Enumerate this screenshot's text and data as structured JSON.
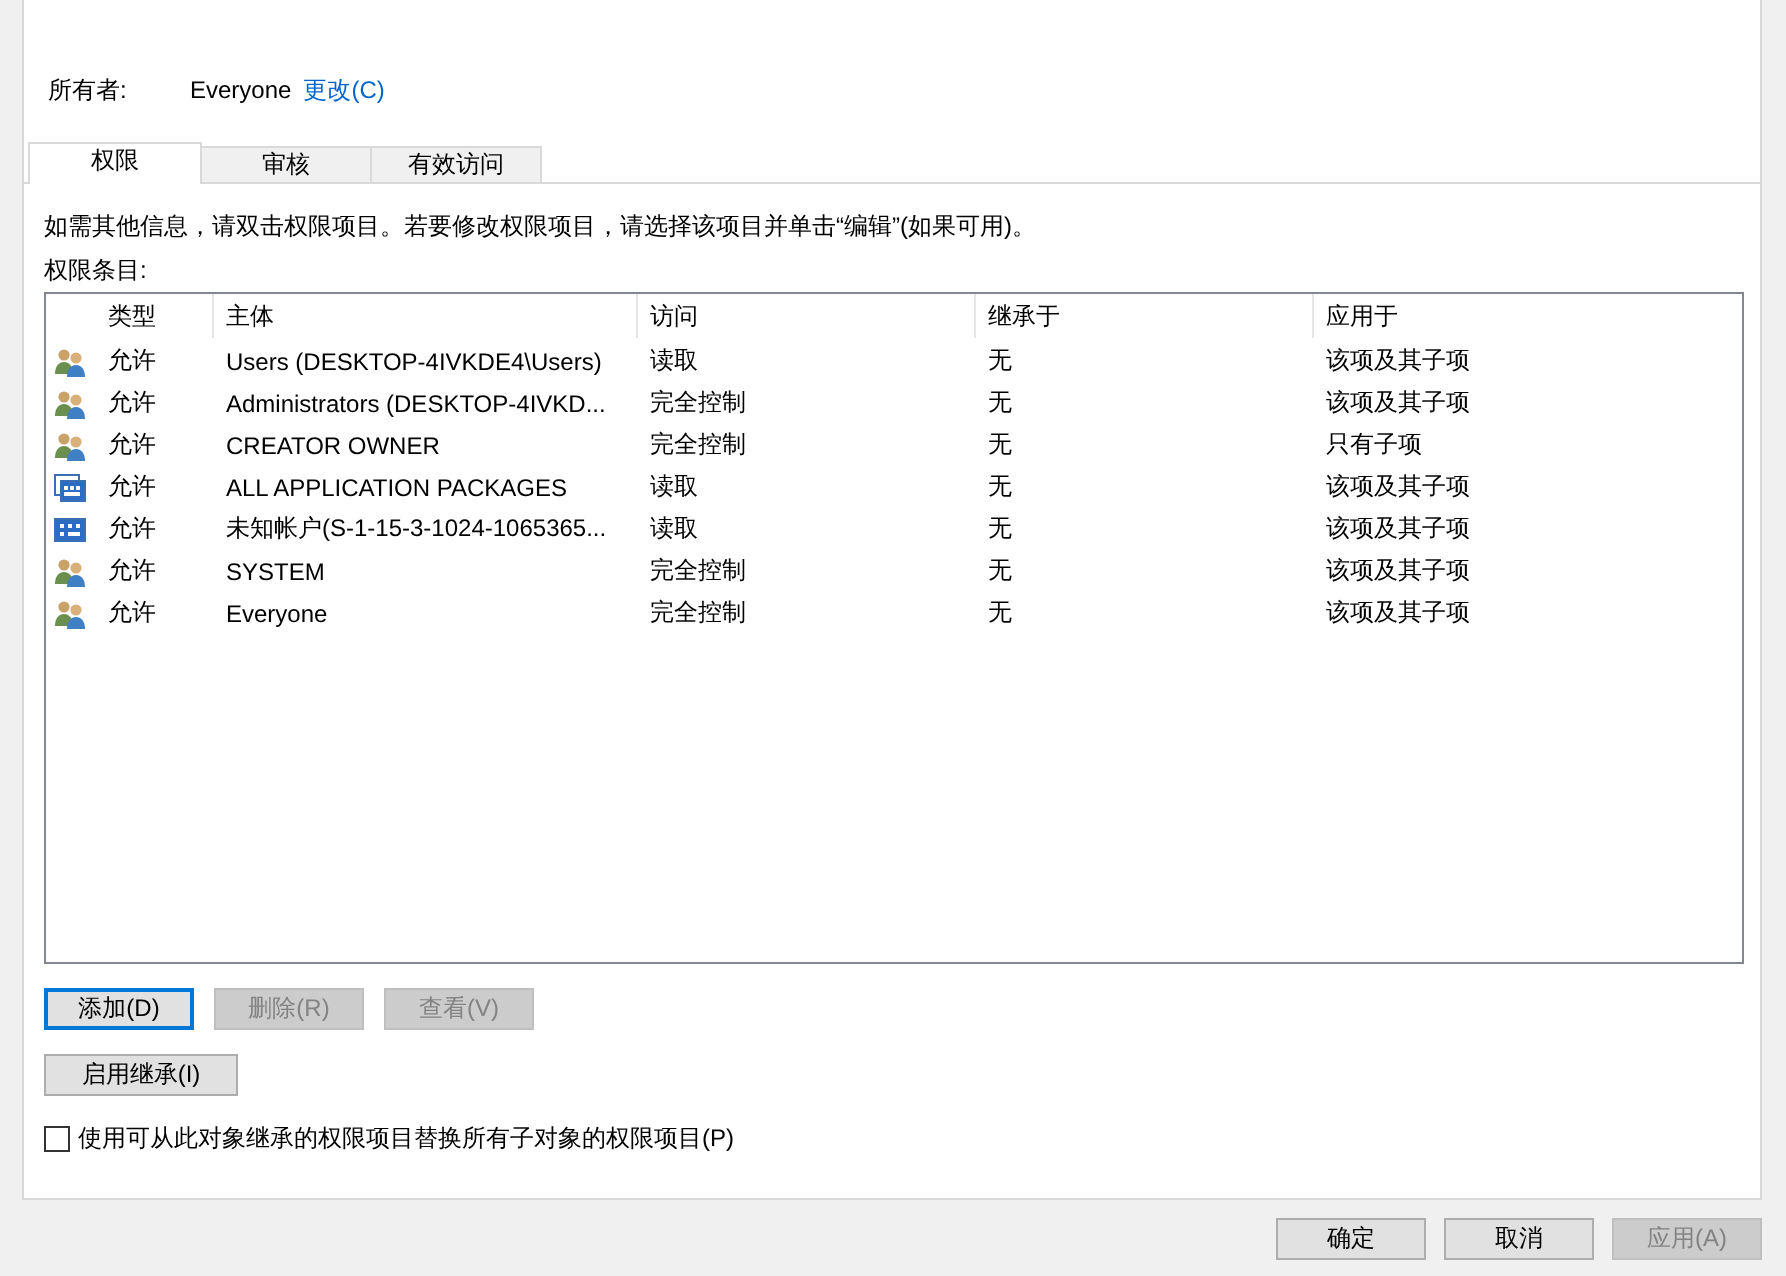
{
  "owner": {
    "label": "所有者:",
    "value": "Everyone",
    "link": "更改(C)"
  },
  "tabs": [
    {
      "label": "权限",
      "selected": true
    },
    {
      "label": "审核",
      "selected": false
    },
    {
      "label": "有效访问",
      "selected": false
    }
  ],
  "info": "如需其他信息，请双击权限项目。若要修改权限项目，请选择该项目并单击“编辑”(如果可用)。",
  "list_label": "权限条目:",
  "table": {
    "columns": [
      "类型",
      "主体",
      "访问",
      "继承于",
      "应用于"
    ],
    "rows": [
      {
        "kind": "group",
        "cells": [
          "允许",
          "Users (DESKTOP-4IVKDE4\\Users)",
          "读取",
          "无",
          "该项及其子项"
        ]
      },
      {
        "kind": "group",
        "cells": [
          "允许",
          "Administrators (DESKTOP-4IVKD...",
          "完全控制",
          "无",
          "该项及其子项"
        ]
      },
      {
        "kind": "group",
        "cells": [
          "允许",
          "CREATOR OWNER",
          "完全控制",
          "无",
          "只有子项"
        ]
      },
      {
        "kind": "app",
        "cells": [
          "允许",
          "ALL APPLICATION PACKAGES",
          "读取",
          "无",
          "该项及其子项"
        ]
      },
      {
        "kind": "app2",
        "cells": [
          "允许",
          "未知帐户(S-1-15-3-1024-1065365...",
          "读取",
          "无",
          "该项及其子项"
        ]
      },
      {
        "kind": "group",
        "cells": [
          "允许",
          "SYSTEM",
          "完全控制",
          "无",
          "该项及其子项"
        ]
      },
      {
        "kind": "group",
        "cells": [
          "允许",
          "Everyone",
          "完全控制",
          "无",
          "该项及其子项"
        ]
      }
    ]
  },
  "actions": [
    {
      "label": "添加(D)",
      "disabled": false,
      "focused": true
    },
    {
      "label": "删除(R)",
      "disabled": true,
      "focused": false
    },
    {
      "label": "查看(V)",
      "disabled": true,
      "focused": false
    }
  ],
  "inherit_button": {
    "label": "启用继承(I)",
    "disabled": false
  },
  "replace_checkbox": {
    "label": "使用可从此对象继承的权限项目替换所有子对象的权限项目(P)",
    "checked": false
  },
  "footer_buttons": [
    {
      "label": "确定",
      "disabled": false
    },
    {
      "label": "取消",
      "disabled": false
    },
    {
      "label": "应用(A)",
      "disabled": true
    }
  ]
}
